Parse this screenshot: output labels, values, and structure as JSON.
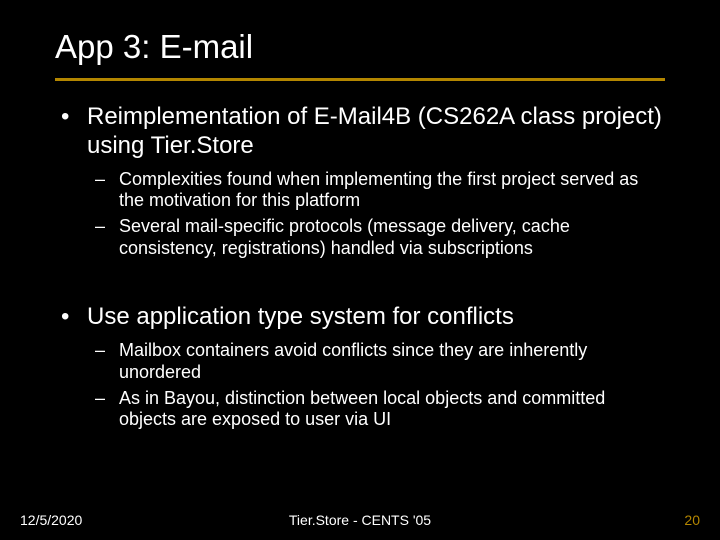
{
  "title": "App 3: E-mail",
  "bullets": [
    {
      "text": "Reimplementation of E-Mail4B (CS262A class project) using Tier.Store",
      "subs": [
        "Complexities found when implementing the first project served as the motivation for this platform",
        "Several mail-specific protocols (message delivery, cache consistency, registrations) handled via subscriptions"
      ]
    },
    {
      "text": "Use application type system for conflicts",
      "subs": [
        "Mailbox containers avoid conflicts since they are inherently unordered",
        "As in Bayou, distinction between local objects and committed objects are exposed to user via UI"
      ]
    }
  ],
  "footer": {
    "date": "12/5/2020",
    "center": "Tier.Store - CENTS '05",
    "page": "20"
  }
}
